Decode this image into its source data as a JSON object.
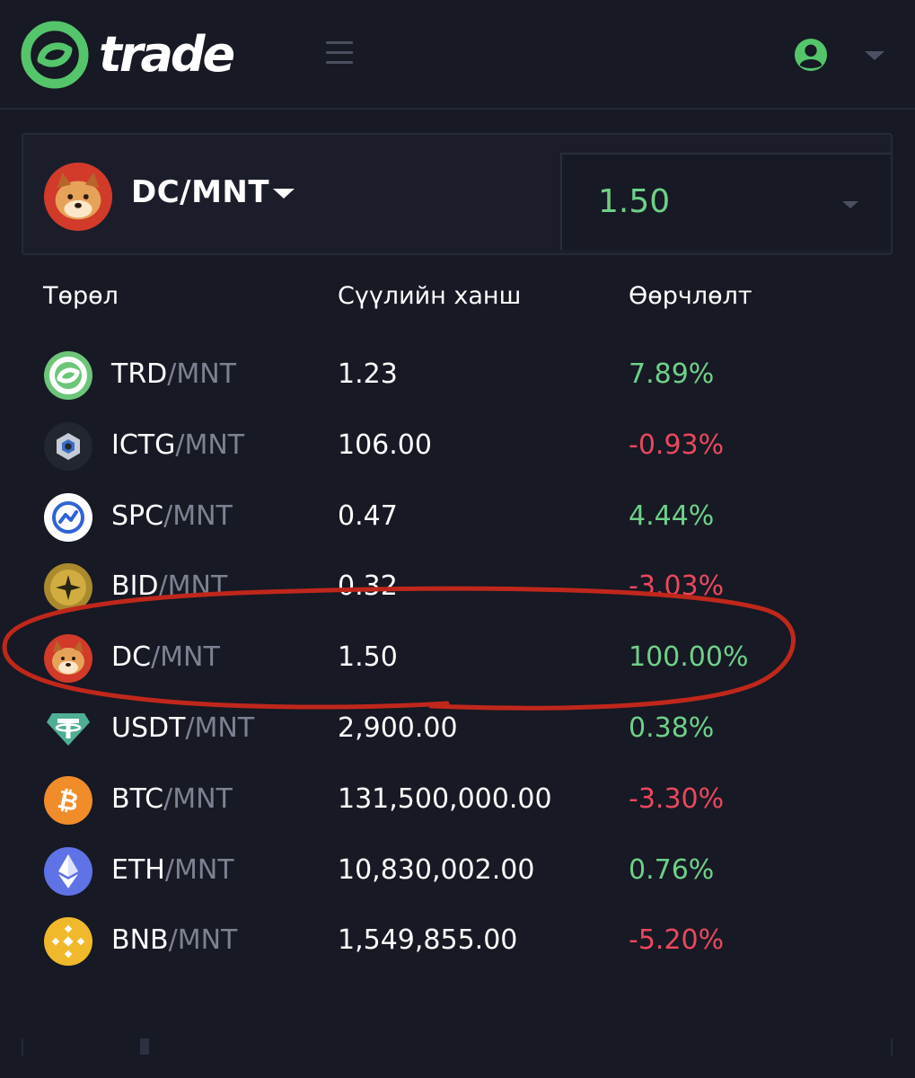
{
  "header": {
    "brand": "trade",
    "logo_icon": "trade-logo-icon",
    "menu_icon": "hamburger-menu-icon",
    "user_icon": "user-account-icon",
    "user_caret_icon": "chevron-down-icon"
  },
  "pair_panel": {
    "pair_label": "DC/MNT",
    "price": "1.50",
    "avatar_icon": "dc-coin-icon"
  },
  "table": {
    "headers": {
      "type": "Төрөл",
      "last_price": "Сүүлийн ханш",
      "change": "Өөрчлөлт"
    },
    "rows": [
      {
        "base": "TRD",
        "quote": "/MNT",
        "last": "1.23",
        "change": "7.89%",
        "direction": "up",
        "icon": "trd-coin-icon"
      },
      {
        "base": "ICTG",
        "quote": "/MNT",
        "last": "106.00",
        "change": "-0.93%",
        "direction": "down",
        "icon": "ictg-coin-icon"
      },
      {
        "base": "SPC",
        "quote": "/MNT",
        "last": "0.47",
        "change": "4.44%",
        "direction": "up",
        "icon": "spc-coin-icon"
      },
      {
        "base": "BID",
        "quote": "/MNT",
        "last": "0.32",
        "change": "-3.03%",
        "direction": "down",
        "icon": "bid-coin-icon"
      },
      {
        "base": "DC",
        "quote": "/MNT",
        "last": "1.50",
        "change": "100.00%",
        "direction": "up",
        "icon": "dc-coin-icon"
      },
      {
        "base": "USDT",
        "quote": "/MNT",
        "last": "2,900.00",
        "change": "0.38%",
        "direction": "up",
        "icon": "usdt-coin-icon"
      },
      {
        "base": "BTC",
        "quote": "/MNT",
        "last": "131,500,000.00",
        "change": "-3.30%",
        "direction": "down",
        "icon": "btc-coin-icon"
      },
      {
        "base": "ETH",
        "quote": "/MNT",
        "last": "10,830,002.00",
        "change": "0.76%",
        "direction": "up",
        "icon": "eth-coin-icon"
      },
      {
        "base": "BNB",
        "quote": "/MNT",
        "last": "1,549,855.00",
        "change": "-5.20%",
        "direction": "down",
        "icon": "bnb-coin-icon"
      }
    ]
  },
  "colors": {
    "background": "#171924",
    "positive": "#6fd088",
    "negative": "#e9485d",
    "quote_text": "#7d8192",
    "annotation_circle": "#c0271b"
  }
}
